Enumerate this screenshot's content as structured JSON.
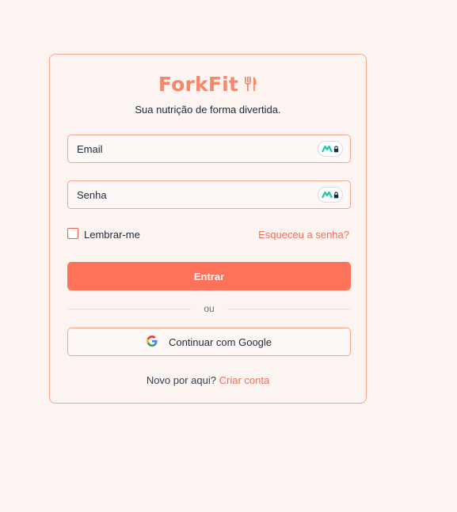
{
  "brand": {
    "name": "ForkFit",
    "icon": "fork-knife-icon",
    "tagline": "Sua nutrição de forma divertida.",
    "accent_color": "#f5886a"
  },
  "form": {
    "email_placeholder": "Email",
    "password_placeholder": "Senha",
    "password_manager_icon": "password-manager-icon",
    "remember_label": "Lembrar-me",
    "remember_checked": false,
    "forgot_label": "Esqueceu a senha?",
    "submit_label": "Entrar",
    "submit_color": "#ff725a"
  },
  "divider": {
    "label": "ou"
  },
  "google": {
    "label": "Continuar com Google",
    "icon": "google-icon"
  },
  "signup": {
    "prompt": "Novo por aqui?",
    "link_label": "Criar conta"
  }
}
